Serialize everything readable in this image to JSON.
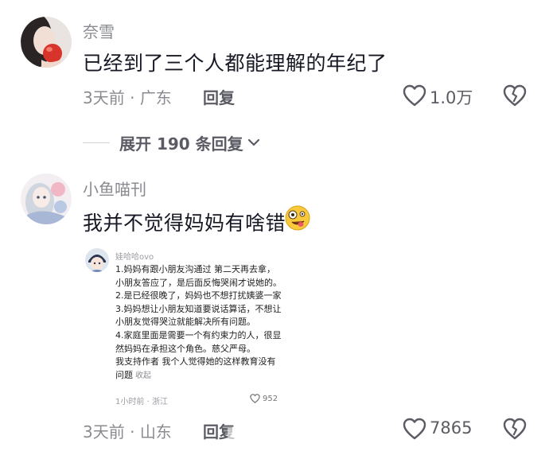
{
  "comments": [
    {
      "username": "奈雪",
      "text": "已经到了三个人都能理解的年纪了",
      "time": "3天前",
      "separator": "·",
      "location": "广东",
      "reply_label": "回复",
      "likes": "1.0万"
    },
    {
      "username": "小鱼喵刊",
      "text": "我并不觉得妈妈有啥错",
      "time": "3天前",
      "separator": "·",
      "location": "山东",
      "reply_label": "回复",
      "likes": "7865",
      "emoji_icon": "crazy-face-emoji-icon",
      "embed": {
        "username": "娃哈哈ovo",
        "lines": [
          "1.妈妈有跟小朋友沟通过 第二天再去拿，",
          "小朋友答应了，是后面反悔哭闹才说她的。",
          "2.是已经很晚了，妈妈也不想打扰姨婆一家",
          "3.妈妈想让小朋友知道要说话算话，不想让",
          "小朋友觉得哭泣就能解决所有问题。",
          "4.家庭里面是需要一个有约束力的人，很显",
          "然妈妈在承担这个角色。慈父严母。",
          "我支持作者 我个人觉得她的这样教育没有",
          "问题"
        ],
        "collapse_label": "收起",
        "time": "1小时前",
        "separator": "·",
        "location": "浙江",
        "likes": "952"
      }
    }
  ],
  "expand": {
    "label": "展开 190 条回复"
  },
  "colors": {
    "text_primary": "#161823",
    "text_secondary": "#8a8b91",
    "action": "#5a5b63"
  }
}
